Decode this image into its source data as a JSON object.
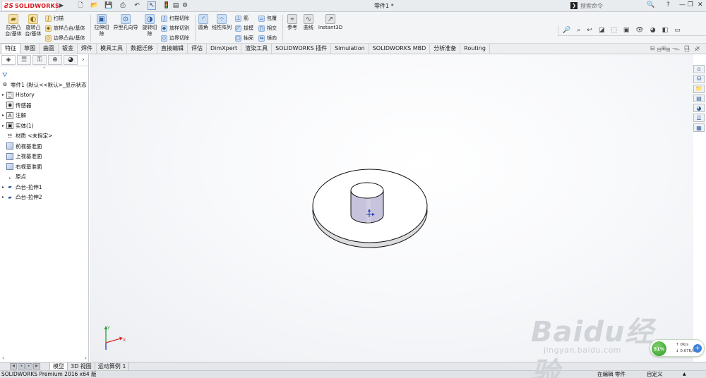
{
  "app": {
    "logo_text": "SOLIDWORKS",
    "document_title": "零件1 *",
    "search_placeholder": "搜索命令",
    "help_label": "?"
  },
  "commands": {
    "extrude_boss": "拉伸凸台/基体",
    "revolve_boss": "旋转凸台/基体",
    "sweep": "扫描",
    "loft": "放样凸台/基体",
    "boundary_boss": "边界凸台/基体",
    "extrude_cut": "拉伸切除",
    "hole_wizard": "异型孔向导",
    "revolve_cut": "旋转切除",
    "swept_cut": "扫描切除",
    "lofted_cut": "放样切割",
    "boundary_cut": "边界切除",
    "fillet": "圆角",
    "linear_pattern": "线性阵列",
    "rib": "筋",
    "draft": "拔模",
    "shell": "抽壳",
    "wrap": "包覆",
    "intersect": "相交",
    "mirror": "镜向",
    "reference": "参考",
    "curves": "曲线",
    "instant3d": "Instant3D"
  },
  "tabs": [
    "特征",
    "草图",
    "曲面",
    "钣金",
    "焊件",
    "模具工具",
    "数据迁移",
    "直接编辑",
    "评估",
    "DimXpert",
    "渲染工具",
    "SOLIDWORKS 插件",
    "Simulation",
    "SOLIDWORKS MBD",
    "分析准备",
    "Routing"
  ],
  "feature_tree": {
    "root": "零件1 (默认<<默认>_显示状态",
    "items": [
      {
        "label": "History",
        "icon": "history-icon",
        "expandable": true
      },
      {
        "label": "传感器",
        "icon": "sensor-icon",
        "expandable": false
      },
      {
        "label": "注解",
        "icon": "annotation-icon",
        "expandable": true
      },
      {
        "label": "实体(1)",
        "icon": "solid-bodies-icon",
        "expandable": true
      },
      {
        "label": "材质 <未指定>",
        "icon": "material-icon",
        "expandable": false
      },
      {
        "label": "前视基准面",
        "icon": "plane-icon",
        "expandable": false
      },
      {
        "label": "上视基准面",
        "icon": "plane-icon",
        "expandable": false
      },
      {
        "label": "右视基准面",
        "icon": "plane-icon",
        "expandable": false
      },
      {
        "label": "原点",
        "icon": "origin-icon",
        "expandable": false
      },
      {
        "label": "凸台-拉伸1",
        "icon": "extrude-feature-icon",
        "expandable": true
      },
      {
        "label": "凸台-拉伸2",
        "icon": "extrude-feature-icon",
        "expandable": true
      }
    ]
  },
  "model_tabs": [
    "模型",
    "3D 视图",
    "运动算例 1"
  ],
  "status": {
    "product": "SOLIDWORKS Premium 2016 x64 版",
    "mode": "在编辑 零件",
    "custom": "自定义"
  },
  "network": {
    "percent": "51%",
    "up": "0K/s",
    "down": "0.07K/s"
  },
  "watermark": {
    "logo": "Baidu经验",
    "url": "jingyan.baidu.com"
  },
  "colors": {
    "brand_red": "#d5121b",
    "selection_blue": "#2d5a96",
    "axis_x": "#d62a2a",
    "axis_y": "#2ca02c",
    "axis_z": "#1f3fb8"
  }
}
